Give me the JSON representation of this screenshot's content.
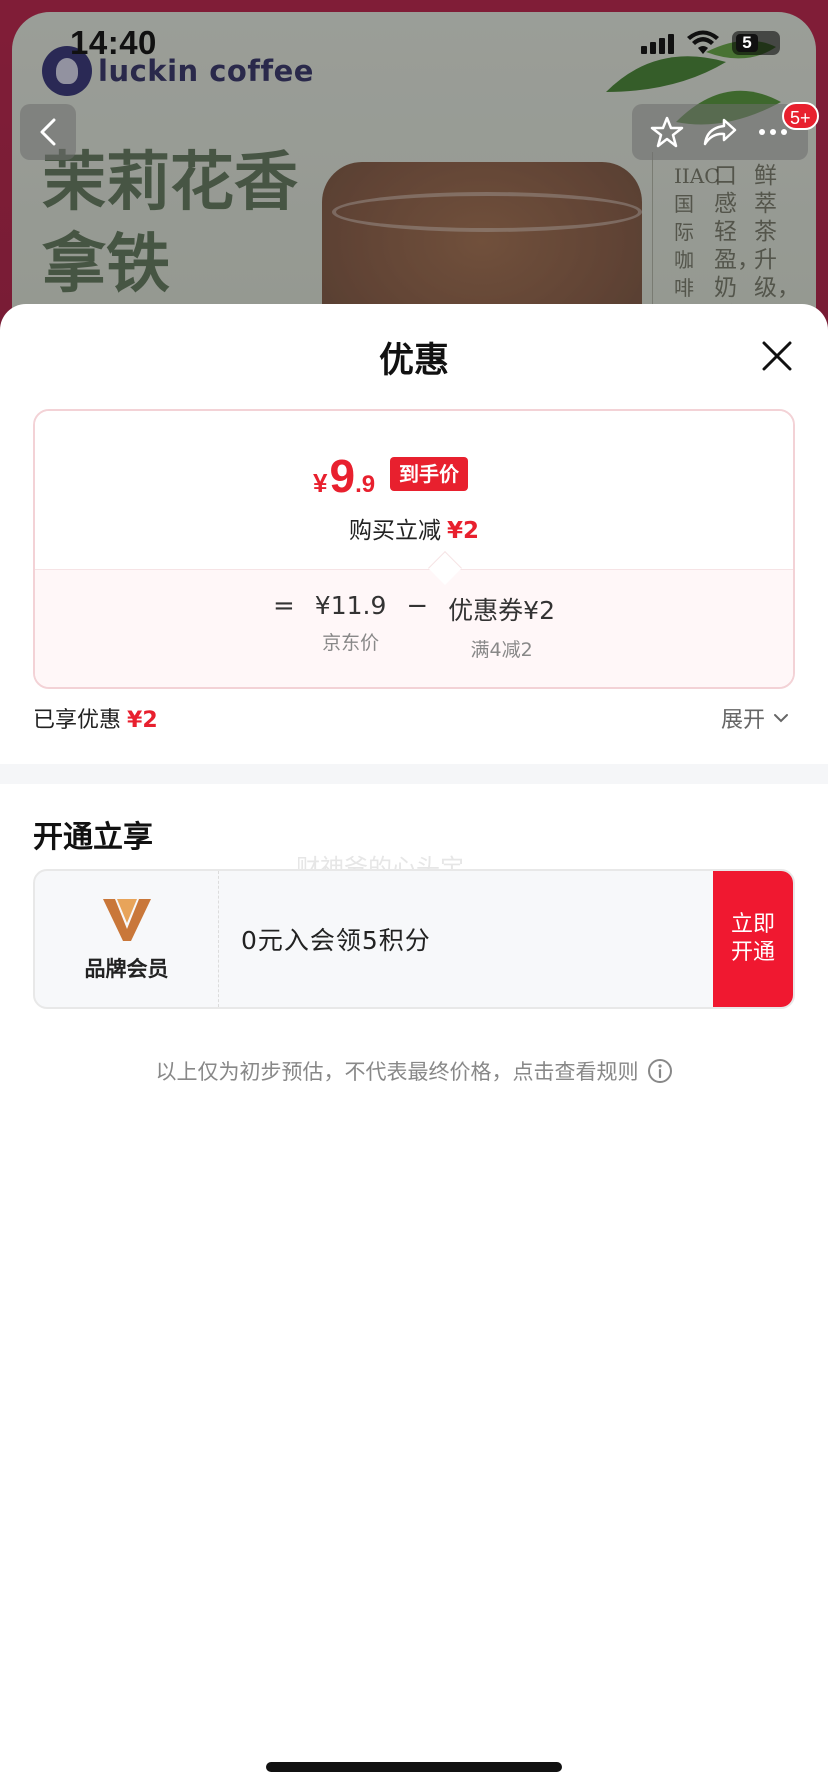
{
  "status_bar": {
    "time": "14:40",
    "battery": "5"
  },
  "background": {
    "brand": "luckin coffee",
    "headline_line1": "茉莉花香",
    "headline_line2": "拿铁",
    "vertical_texts": [
      "鲜萃茶升级，回",
      "口感轻盈，奶香",
      "IIAC国际咖啡品"
    ]
  },
  "nav": {
    "badge": "5+"
  },
  "sheet": {
    "title": "优惠",
    "price": {
      "currency": "¥",
      "integer": "9",
      "decimal": ".9",
      "tag": "到手价"
    },
    "discount": {
      "label": "购买立减",
      "amount": "¥2"
    },
    "formula": {
      "equals": "=",
      "jd_price": "¥11.9",
      "jd_label": "京东价",
      "minus": "−",
      "coupon": "优惠券¥2",
      "coupon_rule": "满4减2"
    },
    "enjoyed": {
      "label": "已享优惠",
      "amount": "¥2"
    },
    "expand_label": "展开",
    "section_title": "开通立享",
    "watermark": "财神爷的心头宝",
    "member": {
      "brand_label": "品牌会员",
      "offer": "0元入会领5积分",
      "button_line1": "立即",
      "button_line2": "开通"
    },
    "disclaimer": "以上仅为初步预估，不代表最终价格，点击查看规则"
  },
  "colors": {
    "accent_red": "#e8202e",
    "button_red": "#f01830",
    "brand_navy": "#2b2a6e",
    "member_orange": "#c9773a"
  }
}
